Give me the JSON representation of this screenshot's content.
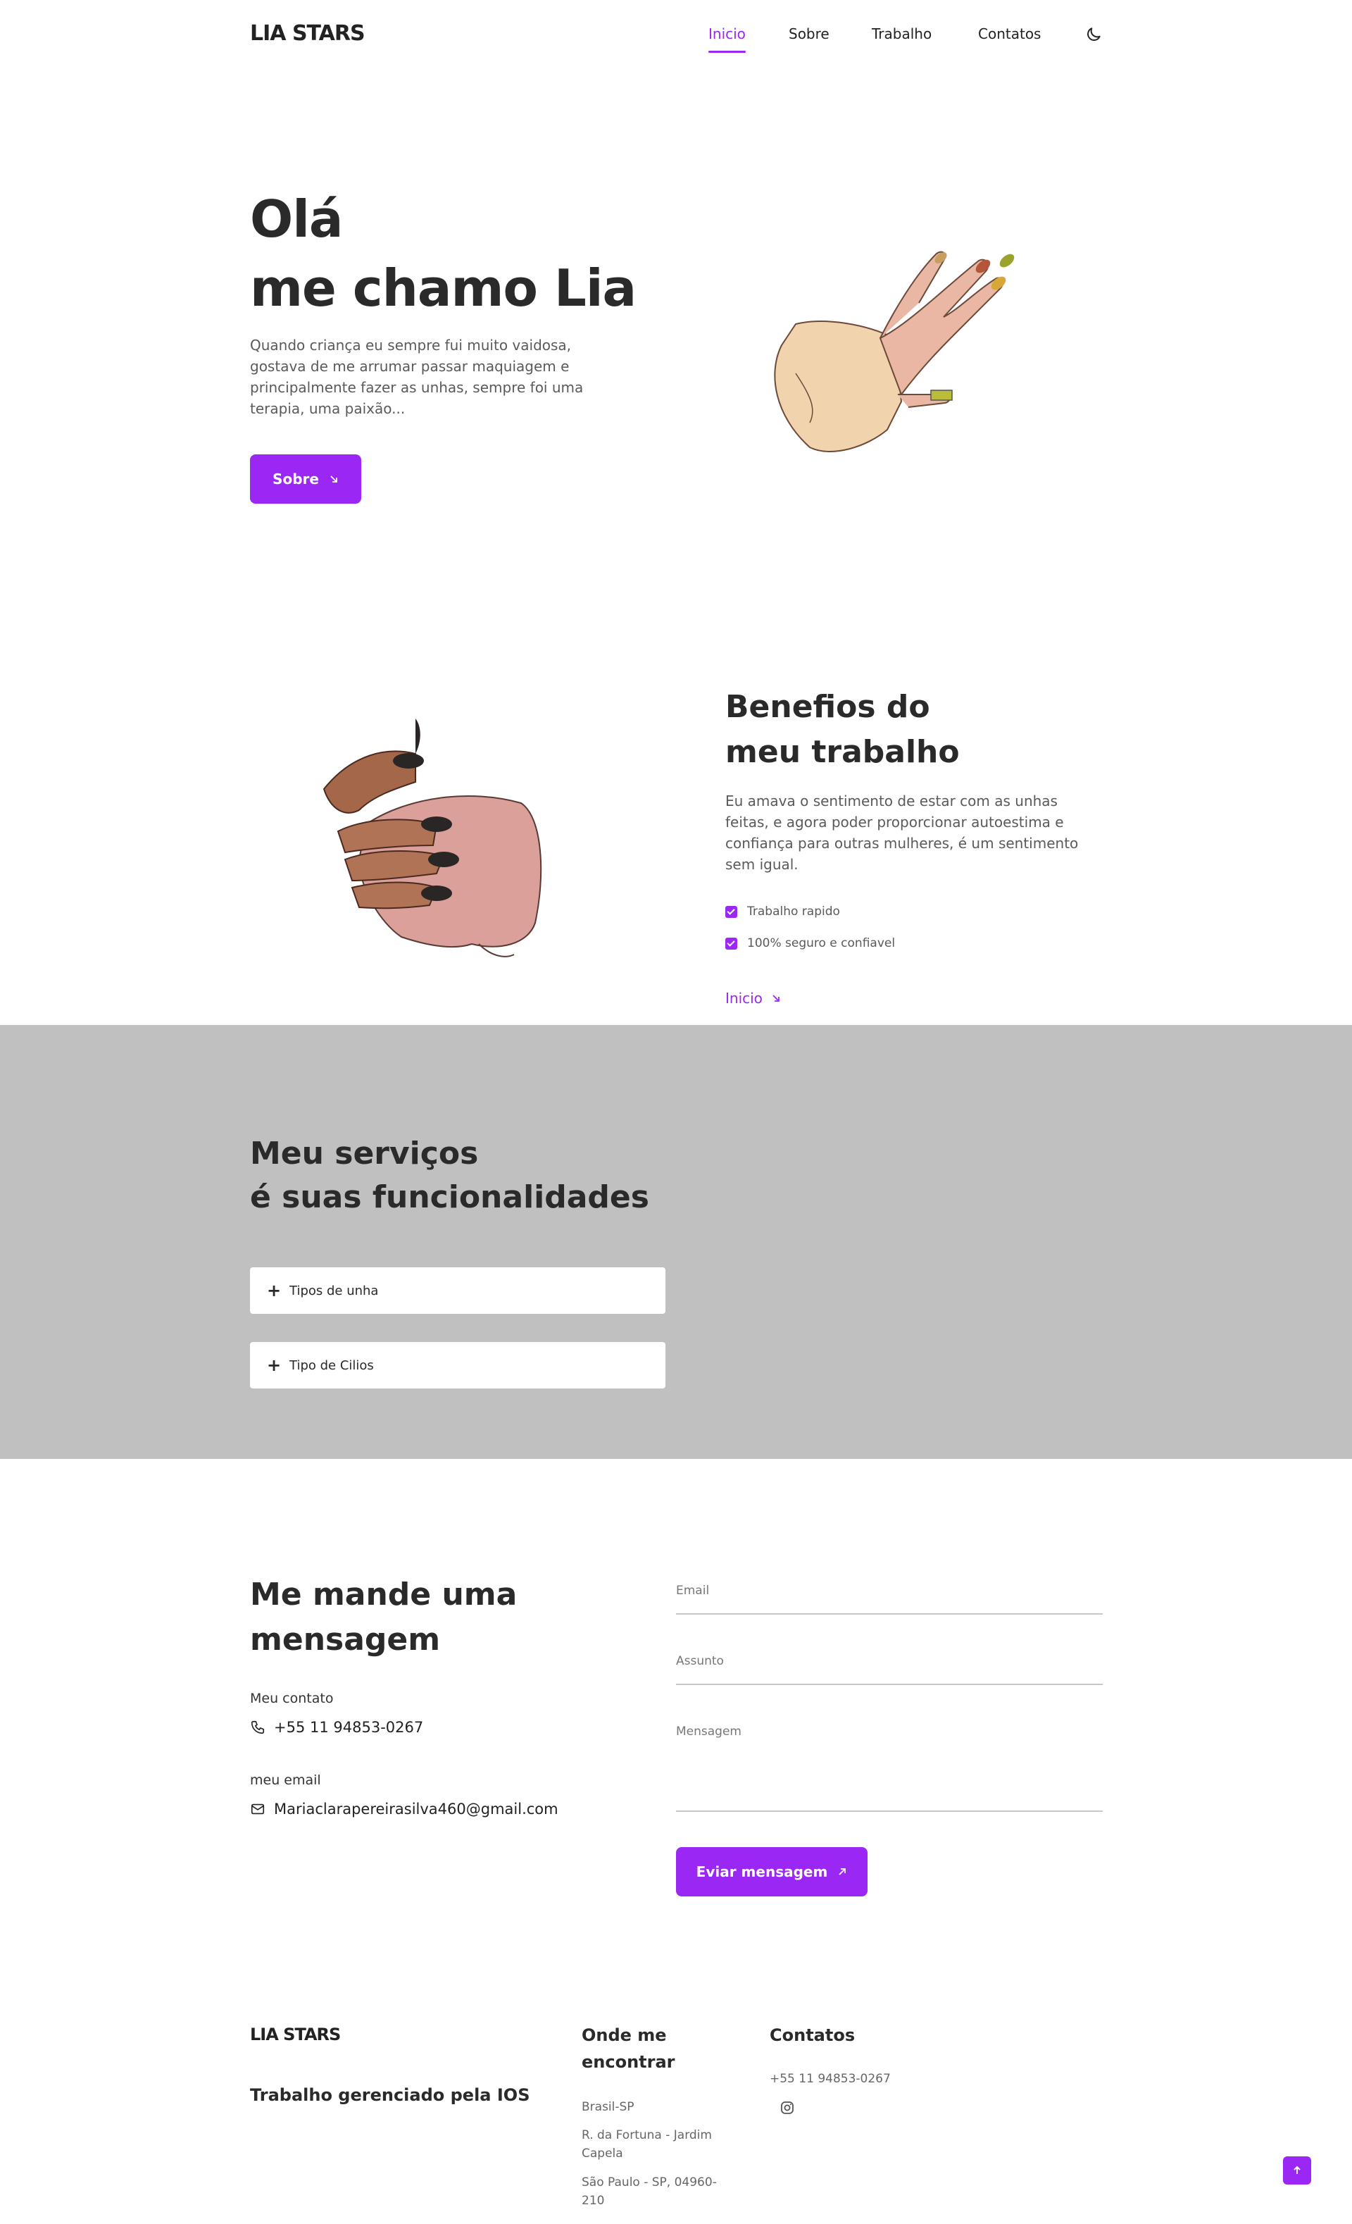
{
  "brand": {
    "logo": "LIA STARS",
    "accent": "#9b27f5"
  },
  "nav": {
    "items": [
      "Inicio",
      "Sobre",
      "Trabalho",
      "Contatos"
    ],
    "active": "Inicio",
    "theme_icon": "moon-icon"
  },
  "hero": {
    "title_line1": "Olá",
    "title_line2": "me chamo Lia",
    "description": "Quando criança eu sempre fui muito vaidosa, gostava de me arrumar passar maquiagem e principalmente fazer as unhas, sempre foi uma terapia, uma paixão...",
    "button": "Sobre"
  },
  "benefits": {
    "title_line1": "Benefios do",
    "title_line2": "meu trabalho",
    "description": "Eu amava o sentimento de estar com as unhas feitas, e agora poder proporcionar autoestima e confiança para outras mulheres, é um sentimento sem igual.",
    "checks": [
      "Trabalho rapido",
      "100% seguro e confiavel"
    ],
    "link": "Inicio"
  },
  "services": {
    "title_line1": "Meu serviços",
    "title_line2": "é suas funcionalidades",
    "items": [
      "Tipos de unha",
      "Tipo de Cilios"
    ],
    "background": "#c0c0c0"
  },
  "contact": {
    "title_line1": "Me mande uma",
    "title_line2": "mensagem",
    "phone_label": "Meu contato",
    "phone": "+55 11 94853-0267",
    "email_label": "meu email",
    "email": "Mariaclarapereirasilva460@gmail.com",
    "form": {
      "email": "Email",
      "subject": "Assunto",
      "message": "Mensagem",
      "button": "Eviar mensagem"
    }
  },
  "footer": {
    "logo": "LIA STARS",
    "subtitle": "Trabalho gerenciado pela IOS",
    "location_title": "Onde me encontrar",
    "location_lines": [
      "Brasil-SP",
      "R. da Fortuna - Jardim Capela",
      "São Paulo - SP, 04960-210"
    ],
    "contacts_title": "Contatos",
    "contacts_phone": "+55 11 94853-0267"
  }
}
